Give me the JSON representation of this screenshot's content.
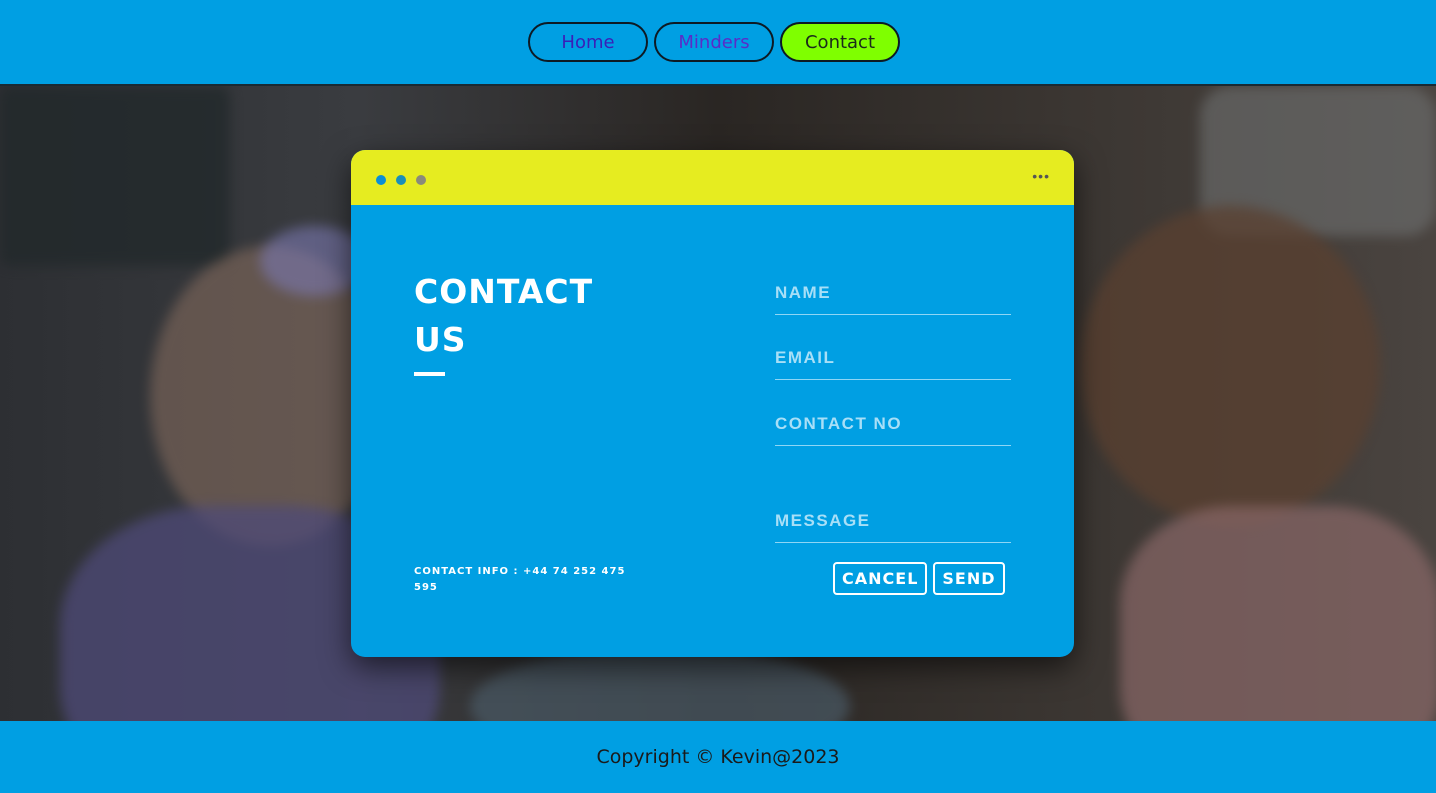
{
  "nav": {
    "items": [
      {
        "label": "Home",
        "active": false
      },
      {
        "label": "Minders",
        "active": false
      },
      {
        "label": "Contact",
        "active": true
      }
    ]
  },
  "card": {
    "window_dots": [
      "blue",
      "blue",
      "gray"
    ],
    "more_icon": "ellipsis-icon",
    "title_line1": "CONTACT",
    "title_line2": "US",
    "contact_info": "CONTACT INFO : +44 74 252 475 595",
    "form": {
      "name_placeholder": "NAME",
      "email_placeholder": "EMAIL",
      "phone_placeholder": "CONTACT NO",
      "message_placeholder": "MESSAGE",
      "cancel_label": "CANCEL",
      "send_label": "SEND"
    }
  },
  "footer": {
    "copyright": "Copyright © Kevin@2023"
  },
  "colors": {
    "primary": "#009fe3",
    "header_bar": "#e6ec20",
    "active_nav": "#7fff00"
  }
}
